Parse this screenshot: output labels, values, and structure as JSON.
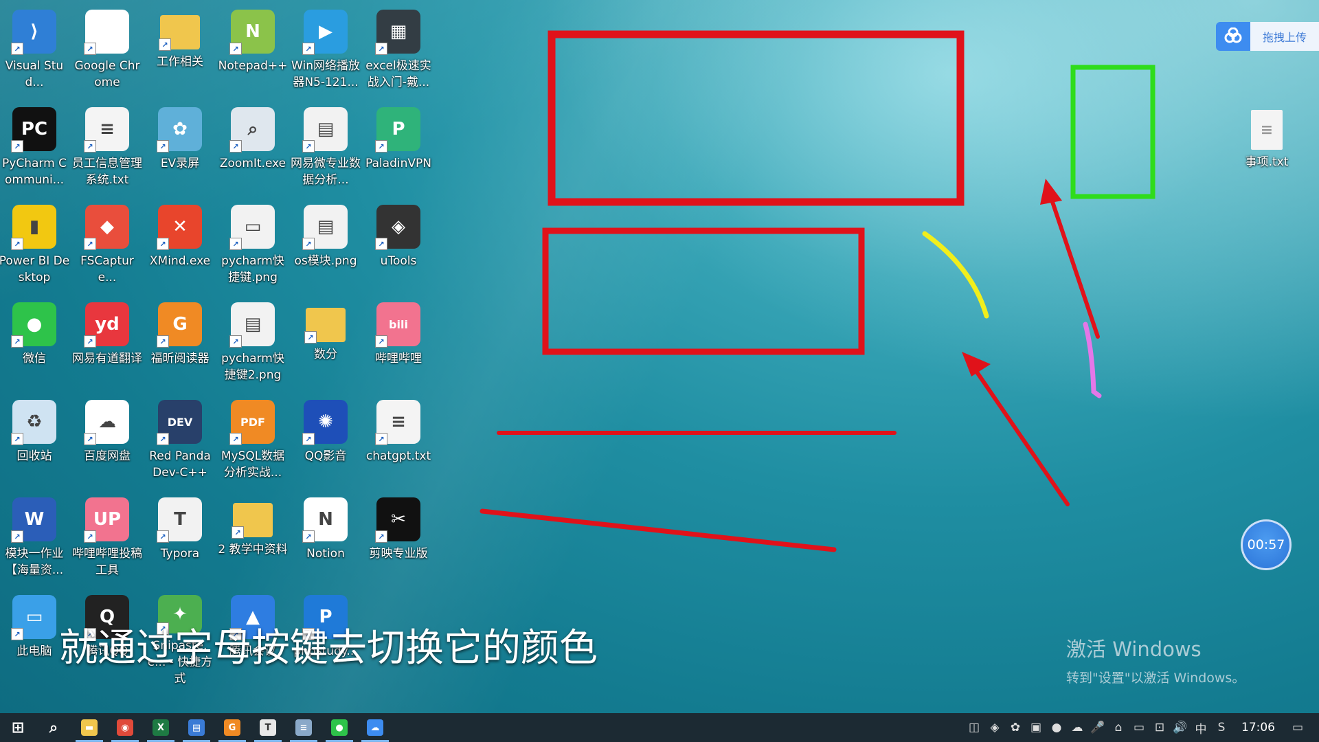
{
  "desktop": {
    "icons": [
      {
        "label": "Visual Stud...",
        "glyph": "⟩",
        "color": "#2f7fd6",
        "icon": "vscode-icon"
      },
      {
        "label": "Google Chrome",
        "glyph": "",
        "color": "#ffffff",
        "icon": "chrome-icon"
      },
      {
        "label": "工作相关",
        "glyph": "",
        "color": "#f0c64d",
        "icon": "folder-icon"
      },
      {
        "label": "Notepad++",
        "glyph": "N",
        "color": "#8bc34a",
        "icon": "notepadpp-icon"
      },
      {
        "label": "Win网络播放器N5-121...",
        "glyph": "▶",
        "color": "#2a9de0",
        "icon": "media-player-icon"
      },
      {
        "label": "excel极速实战入门-戴...",
        "glyph": "▦",
        "color": "#333d44",
        "icon": "video-file-icon"
      },
      {
        "label": "PyCharm Communi...",
        "glyph": "PC",
        "color": "#111111",
        "icon": "pycharm-icon"
      },
      {
        "label": "员工信息管理系统.txt",
        "glyph": "≡",
        "color": "#f4f4f4",
        "icon": "text-file-icon"
      },
      {
        "label": "EV录屏",
        "glyph": "✿",
        "color": "#5fb0d9",
        "icon": "ev-recorder-icon"
      },
      {
        "label": "ZoomIt.exe",
        "glyph": "⌕",
        "color": "#dfe7ee",
        "icon": "zoomit-icon"
      },
      {
        "label": "网易微专业数据分析...",
        "glyph": "▤",
        "color": "#f2f2f2",
        "icon": "image-file-icon"
      },
      {
        "label": "PaladinVPN",
        "glyph": "P",
        "color": "#2fb37a",
        "icon": "vpn-icon"
      },
      {
        "label": "Power BI Desktop",
        "glyph": "▮",
        "color": "#f2c811",
        "icon": "powerbi-icon"
      },
      {
        "label": "FSCapture...",
        "glyph": "◆",
        "color": "#e94e3c",
        "icon": "fscapture-icon"
      },
      {
        "label": "XMind.exe",
        "glyph": "✕",
        "color": "#e8452c",
        "icon": "xmind-icon"
      },
      {
        "label": "pycharm快捷键.png",
        "glyph": "▭",
        "color": "#f2f2f2",
        "icon": "image-file-icon"
      },
      {
        "label": "os模块.png",
        "glyph": "▤",
        "color": "#f2f2f2",
        "icon": "image-file-icon"
      },
      {
        "label": "uTools",
        "glyph": "◈",
        "color": "#333333",
        "icon": "utools-icon"
      },
      {
        "label": "微信",
        "glyph": "●",
        "color": "#2ec34a",
        "icon": "wechat-icon"
      },
      {
        "label": "网易有道翻译",
        "glyph": "yd",
        "color": "#e8373e",
        "icon": "youdao-icon"
      },
      {
        "label": "福昕阅读器",
        "glyph": "G",
        "color": "#f08a24",
        "icon": "foxit-icon"
      },
      {
        "label": "pycharm快捷键2.png",
        "glyph": "▤",
        "color": "#f2f2f2",
        "icon": "image-file-icon"
      },
      {
        "label": "数分",
        "glyph": "",
        "color": "#f0c64d",
        "icon": "folder-icon"
      },
      {
        "label": "哔哩哔哩",
        "glyph": "bili",
        "color": "#f2738f",
        "icon": "bilibili-icon"
      },
      {
        "label": "回收站",
        "glyph": "♻",
        "color": "#cfe3f2",
        "icon": "recycle-bin-icon"
      },
      {
        "label": "百度网盘",
        "glyph": "☁",
        "color": "#ffffff",
        "icon": "baidu-netdisk-icon"
      },
      {
        "label": "Red Panda Dev-C++",
        "glyph": "DEV",
        "color": "#28406a",
        "icon": "devcpp-icon"
      },
      {
        "label": "MySQL数据分析实战...",
        "glyph": "PDF",
        "color": "#f08a24",
        "icon": "pdf-file-icon"
      },
      {
        "label": "QQ影音",
        "glyph": "✺",
        "color": "#1e4fb8",
        "icon": "qqplayer-icon"
      },
      {
        "label": "chatgpt.txt",
        "glyph": "≡",
        "color": "#f4f4f4",
        "icon": "text-file-icon"
      },
      {
        "label": "模块一作业【海量资...",
        "glyph": "W",
        "color": "#2b5eb8",
        "icon": "word-doc-icon"
      },
      {
        "label": "哔哩哔哩投稿工具",
        "glyph": "UP",
        "color": "#f2738f",
        "icon": "bilibili-upload-icon"
      },
      {
        "label": "Typora",
        "glyph": "T",
        "color": "#f2f2f2",
        "icon": "typora-icon"
      },
      {
        "label": "2 教学中资料",
        "glyph": "",
        "color": "#f0c64d",
        "icon": "folder-icon"
      },
      {
        "label": "Notion",
        "glyph": "N",
        "color": "#ffffff",
        "icon": "notion-icon"
      },
      {
        "label": "剪映专业版",
        "glyph": "✂",
        "color": "#111111",
        "icon": "capcut-icon"
      },
      {
        "label": "此电脑",
        "glyph": "▭",
        "color": "#3aa0e8",
        "icon": "this-pc-icon"
      },
      {
        "label": "腾讯QQ",
        "glyph": "Q",
        "color": "#222222",
        "icon": "qq-icon"
      },
      {
        "label": "Snipaste.e... - 快捷方式",
        "glyph": "✦",
        "color": "#4caf50",
        "icon": "snipaste-icon"
      },
      {
        "label": "腾讯会议",
        "glyph": "▲",
        "color": "#2e7de1",
        "icon": "tencent-meeting-icon"
      },
      {
        "label": "phpstudy...",
        "glyph": "P",
        "color": "#1f7ad8",
        "icon": "phpstudy-icon"
      }
    ],
    "right_file": {
      "label": "事项.txt",
      "icon": "text-file-icon"
    }
  },
  "upload_widget": {
    "label": "拖拽上传",
    "icon": "baidu-netdisk-icon"
  },
  "subtitle": "就通过字母按键去切换它的颜色",
  "activation": {
    "line1": "激活 Windows",
    "line2": "转到\"设置\"以激活 Windows。"
  },
  "timer": "00:57",
  "taskbar": {
    "apps": [
      {
        "name": "start-button",
        "glyph": "⊞",
        "color": "transparent"
      },
      {
        "name": "search-button",
        "glyph": "⌕",
        "color": "transparent"
      },
      {
        "name": "taskbar-file-explorer",
        "glyph": "▬",
        "color": "#f0c64d"
      },
      {
        "name": "taskbar-chrome",
        "glyph": "◉",
        "color": "#e04a3a"
      },
      {
        "name": "taskbar-excel",
        "glyph": "X",
        "color": "#1e7a43"
      },
      {
        "name": "taskbar-app-blue",
        "glyph": "▤",
        "color": "#3a7bd5"
      },
      {
        "name": "taskbar-foxit",
        "glyph": "G",
        "color": "#f08a24"
      },
      {
        "name": "taskbar-typora",
        "glyph": "T",
        "color": "#e8e8e8"
      },
      {
        "name": "taskbar-notepad",
        "glyph": "≡",
        "color": "#8aa9c9"
      },
      {
        "name": "taskbar-wechat",
        "glyph": "●",
        "color": "#2ec34a"
      },
      {
        "name": "taskbar-baidu-netdisk",
        "glyph": "☁",
        "color": "#3d8cf0"
      }
    ],
    "tray": [
      "◫",
      "◈",
      "✿",
      "▣",
      "●",
      "☁",
      "🎤",
      "⌂",
      "▭",
      "⊡",
      "🔊",
      "中",
      "S"
    ],
    "tray_names": [
      "tray-app-icon",
      "tray-utools-icon",
      "tray-app2-icon",
      "tray-message-icon",
      "tray-wechat-icon",
      "tray-netdisk-icon",
      "tray-mic-icon",
      "tray-network-icon",
      "tray-battery-icon",
      "tray-display-icon",
      "volume-icon",
      "ime-indicator",
      "sogou-ime-icon"
    ],
    "clock": "17:06"
  },
  "colors": {
    "annotation_red": "#e0121a",
    "annotation_green": "#2fdc1c",
    "annotation_yellow": "#f1ee1c",
    "annotation_pink": "#e477e8"
  }
}
